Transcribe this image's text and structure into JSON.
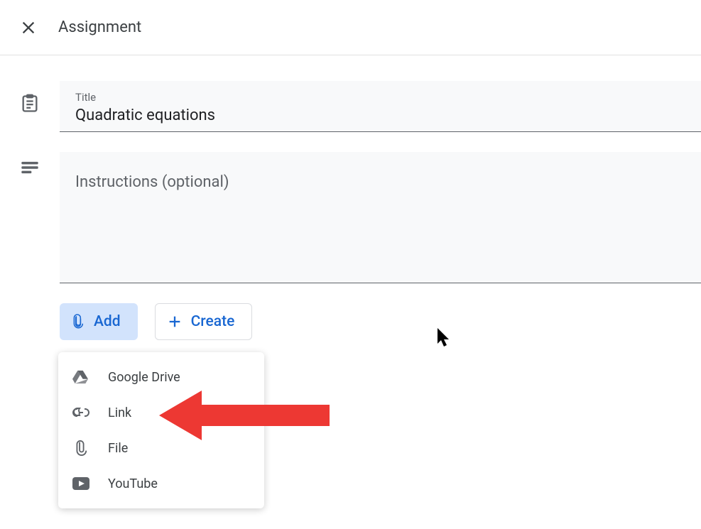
{
  "header": {
    "title": "Assignment"
  },
  "form": {
    "title_label": "Title",
    "title_value": "Quadratic equations",
    "instructions_placeholder": "Instructions (optional)"
  },
  "buttons": {
    "add": "Add",
    "create": "Create"
  },
  "dropdown": {
    "items": [
      {
        "label": "Google Drive",
        "icon": "drive-icon"
      },
      {
        "label": "Link",
        "icon": "link-icon"
      },
      {
        "label": "File",
        "icon": "attachment-icon"
      },
      {
        "label": "YouTube",
        "icon": "youtube-icon"
      }
    ]
  }
}
